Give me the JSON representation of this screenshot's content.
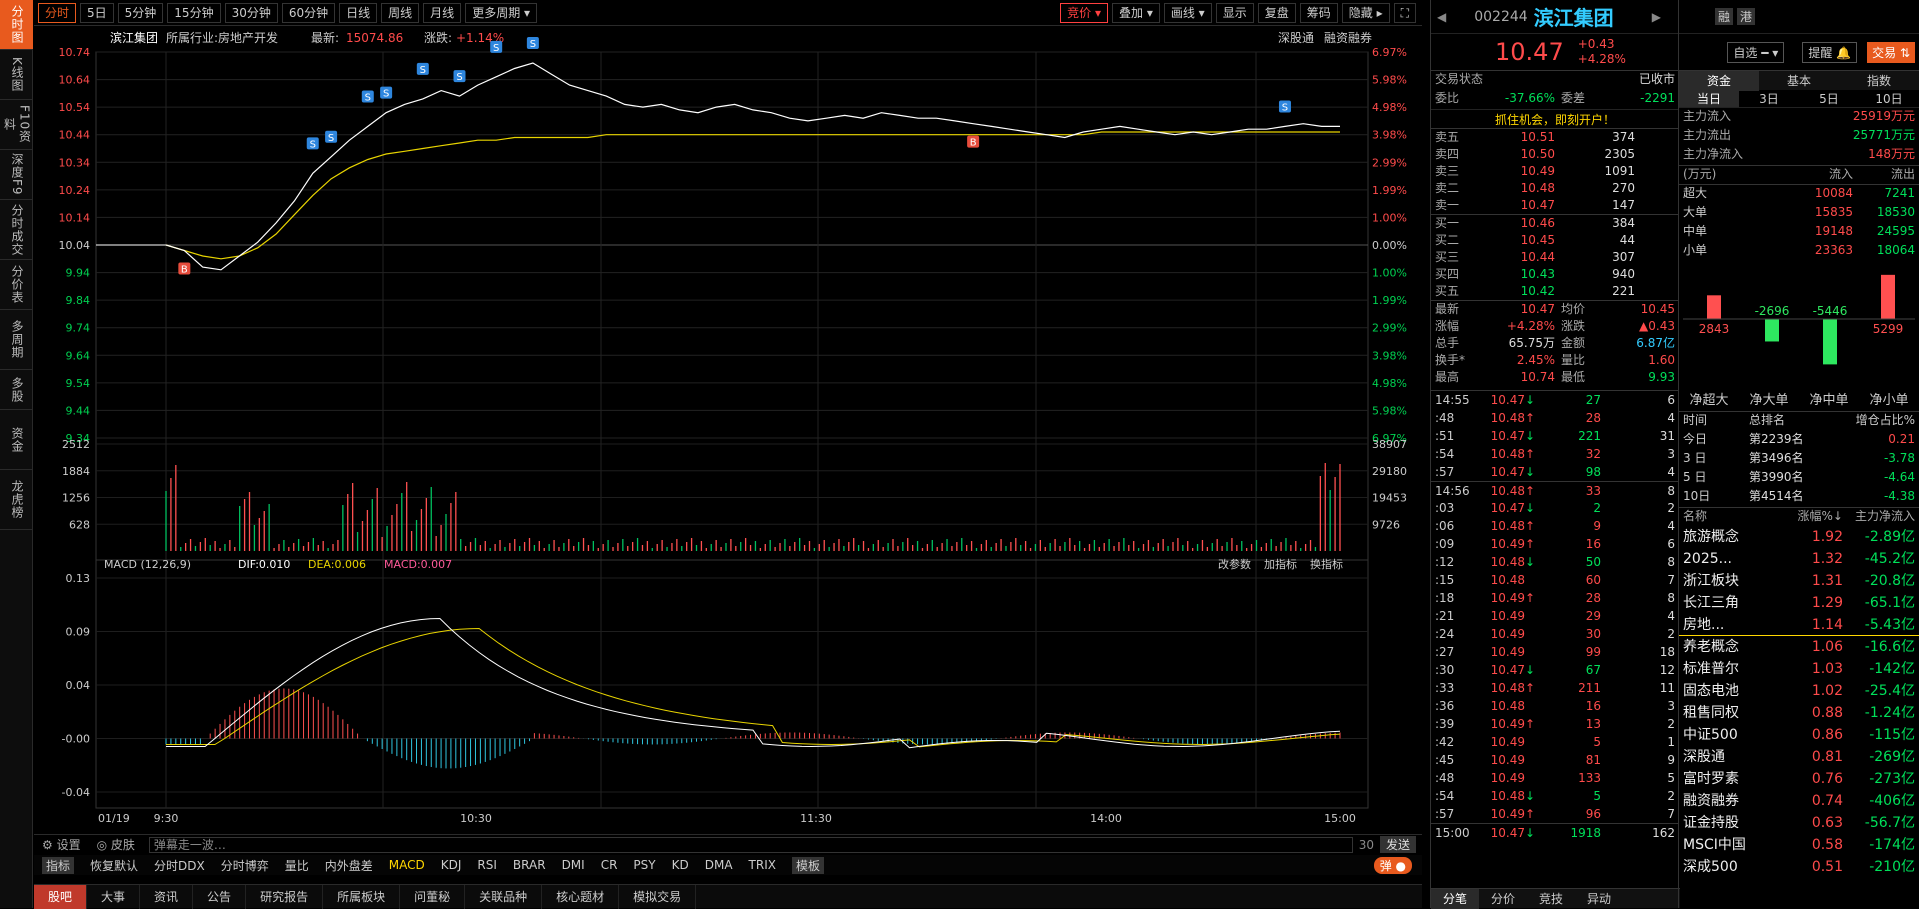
{
  "nav": [
    "分时图",
    "K线图",
    "F10资料",
    "深度F9",
    "分时成交",
    "分价表",
    "多周期",
    "多股",
    "资金",
    "龙虎榜"
  ],
  "topbar": {
    "periods": [
      "分时",
      "5日",
      "5分钟",
      "15分钟",
      "30分钟",
      "60分钟",
      "日线",
      "周线",
      "月线",
      "更多周期"
    ],
    "right": [
      "竞价",
      "叠加",
      "画线",
      "显示",
      "复盘",
      "筹码",
      "隐藏"
    ]
  },
  "stock": {
    "name": "滨江集团",
    "industry_label": "所属行业:",
    "industry": "房地产开发",
    "latest_label": "最新:",
    "latest": "15074.86",
    "change_label": "涨跌:",
    "change": "+1.14%",
    "tags": [
      "深股通",
      "融资融券"
    ]
  },
  "chart_data": {
    "type": "line",
    "title": "滨江集团 分时",
    "x_ticks": [
      "9:30",
      "10:30",
      "11:30",
      "14:00",
      "15:00"
    ],
    "date": "01/19",
    "price_ticks": [
      "10.74",
      "10.64",
      "10.54",
      "10.44",
      "10.34",
      "10.24",
      "10.14",
      "10.04",
      "9.94",
      "9.84",
      "9.74",
      "9.64",
      "9.54",
      "9.44",
      "9.34"
    ],
    "pct_ticks": [
      "6.97%",
      "5.98%",
      "4.98%",
      "3.98%",
      "2.99%",
      "1.99%",
      "1.00%",
      "0.00%",
      "1.00%",
      "1.99%",
      "2.99%",
      "3.98%",
      "4.98%",
      "5.98%",
      "6.97%"
    ],
    "vol_ticks_left": [
      "2512",
      "1884",
      "1256",
      "628"
    ],
    "vol_ticks_right": [
      "38907",
      "29180",
      "19453",
      "9726"
    ],
    "macd_ticks": [
      "0.13",
      "0.09",
      "0.04",
      "-0.00",
      "-0.04"
    ],
    "macd_label": "MACD (12,26,9)",
    "dif": "DIF:0.010",
    "dea": "DEA:0.006",
    "macd": "MACD:0.007",
    "macd_actions": [
      "改参数",
      "加指标",
      "换指标"
    ],
    "price": [
      10.04,
      10.02,
      9.96,
      9.95,
      10.0,
      10.05,
      10.12,
      10.2,
      10.3,
      10.36,
      10.42,
      10.47,
      10.52,
      10.55,
      10.57,
      10.6,
      10.58,
      10.62,
      10.65,
      10.68,
      10.7,
      10.66,
      10.62,
      10.6,
      10.58,
      10.55,
      10.54,
      10.55,
      10.53,
      10.52,
      10.54,
      10.55,
      10.53,
      10.52,
      10.5,
      10.49,
      10.5,
      10.51,
      10.5,
      10.52,
      10.51,
      10.5,
      10.5,
      10.49,
      10.48,
      10.47,
      10.46,
      10.45,
      10.44,
      10.43,
      10.45,
      10.46,
      10.47,
      10.46,
      10.45,
      10.44,
      10.45,
      10.44,
      10.45,
      10.46,
      10.46,
      10.47,
      10.48,
      10.47,
      10.47
    ],
    "avg": [
      10.04,
      10.02,
      10.0,
      9.99,
      10.0,
      10.03,
      10.08,
      10.15,
      10.22,
      10.28,
      10.32,
      10.35,
      10.37,
      10.38,
      10.39,
      10.4,
      10.41,
      10.42,
      10.42,
      10.43,
      10.43,
      10.43,
      10.43,
      10.43,
      10.44,
      10.44,
      10.44,
      10.44,
      10.44,
      10.44,
      10.44,
      10.44,
      10.44,
      10.44,
      10.44,
      10.44,
      10.44,
      10.44,
      10.44,
      10.44,
      10.44,
      10.44,
      10.44,
      10.44,
      10.44,
      10.44,
      10.44,
      10.44,
      10.44,
      10.44,
      10.44,
      10.45,
      10.45,
      10.45,
      10.45,
      10.45,
      10.45,
      10.45,
      10.45,
      10.45,
      10.45,
      10.45,
      10.45,
      10.45,
      10.45
    ],
    "preclose": 10.04,
    "ymin": 9.34,
    "ymax": 10.74,
    "buy_sell_markers": [
      "B",
      "S",
      "S",
      "S",
      "S",
      "S",
      "S",
      "S",
      "S",
      "B",
      "S"
    ]
  },
  "macd_bar_label": "弹幕走一波…",
  "bottom": {
    "settings": "设置",
    "skin": "皮肤",
    "send": "发送",
    "count": "30"
  },
  "indicators": [
    "指标",
    "恢复默认",
    "分时DDX",
    "分时博弈",
    "量比",
    "内外盘差",
    "MACD",
    "KDJ",
    "RSI",
    "BRAR",
    "DMI",
    "CR",
    "PSY",
    "KD",
    "DMA",
    "TRIX",
    "模板"
  ],
  "btabs": [
    "股吧",
    "大事",
    "资讯",
    "公告",
    "研究报告",
    "所属板块",
    "问董秘",
    "关联品种",
    "核心题材",
    "模拟交易"
  ],
  "quote": {
    "code": "002244",
    "name": "滨江集团",
    "price": "10.47",
    "chg": "+0.43",
    "pct": "+4.28%",
    "tags": [
      "融",
      "港"
    ],
    "actions": [
      "自选",
      "提醒",
      "交易"
    ],
    "status_label": "交易状态",
    "status": "已收市",
    "wb_label": "委比",
    "wb": "-37.66%",
    "wc_label": "委差",
    "wc": "-2291",
    "promo": "抓住机会，即刻开户！",
    "asks": [
      [
        "卖五",
        "10.51",
        "374"
      ],
      [
        "卖四",
        "10.50",
        "2305"
      ],
      [
        "卖三",
        "10.49",
        "1091"
      ],
      [
        "卖二",
        "10.48",
        "270"
      ],
      [
        "卖一",
        "10.47",
        "147"
      ]
    ],
    "bids": [
      [
        "买一",
        "10.46",
        "384"
      ],
      [
        "买二",
        "10.45",
        "44"
      ],
      [
        "买三",
        "10.44",
        "307"
      ],
      [
        "买四",
        "10.43",
        "940"
      ],
      [
        "买五",
        "10.42",
        "221"
      ]
    ],
    "stats": [
      [
        "最新",
        "10.47",
        "均价",
        "10.45"
      ],
      [
        "涨幅",
        "+4.28%",
        "涨跌",
        "▲0.43"
      ],
      [
        "总手",
        "65.75万",
        "金额",
        "6.87亿"
      ],
      [
        "换手*",
        "2.45%",
        "量比",
        "1.60"
      ],
      [
        "最高",
        "10.74",
        "最低",
        "9.93"
      ]
    ]
  },
  "ticks": [
    [
      "14:55",
      "10.47",
      "↓",
      "27",
      "6"
    ],
    [
      ":48",
      "10.48",
      "↑",
      "28",
      "4"
    ],
    [
      ":51",
      "10.47",
      "↓",
      "221",
      "31"
    ],
    [
      ":54",
      "10.48",
      "↑",
      "32",
      "3"
    ],
    [
      ":57",
      "10.47",
      "↓",
      "98",
      "4"
    ],
    [
      "14:56",
      "10.48",
      "↑",
      "33",
      "8"
    ],
    [
      ":03",
      "10.47",
      "↓",
      "2",
      "2"
    ],
    [
      ":06",
      "10.48",
      "↑",
      "9",
      "4"
    ],
    [
      ":09",
      "10.49",
      "↑",
      "16",
      "6"
    ],
    [
      ":12",
      "10.48",
      "↓",
      "50",
      "8"
    ],
    [
      ":15",
      "10.48",
      "",
      "60",
      "7"
    ],
    [
      ":18",
      "10.49",
      "↑",
      "28",
      "8"
    ],
    [
      ":21",
      "10.49",
      "",
      "29",
      "4"
    ],
    [
      ":24",
      "10.49",
      "",
      "30",
      "2"
    ],
    [
      ":27",
      "10.49",
      "",
      "99",
      "18"
    ],
    [
      ":30",
      "10.47",
      "↓",
      "67",
      "12"
    ],
    [
      ":33",
      "10.48",
      "↑",
      "211",
      "11"
    ],
    [
      ":36",
      "10.48",
      "",
      "16",
      "3"
    ],
    [
      ":39",
      "10.49",
      "↑",
      "13",
      "2"
    ],
    [
      ":42",
      "10.49",
      "",
      "5",
      "1"
    ],
    [
      ":45",
      "10.49",
      "",
      "81",
      "9"
    ],
    [
      ":48",
      "10.49",
      "",
      "133",
      "5"
    ],
    [
      ":54",
      "10.48",
      "↓",
      "5",
      "2"
    ],
    [
      ":57",
      "10.49",
      "↑",
      "96",
      "7"
    ],
    [
      "15:00",
      "10.47",
      "↓",
      "1918",
      "162"
    ]
  ],
  "tick_tabs": [
    "分笔",
    "分价",
    "竞技",
    "异动"
  ],
  "fund": {
    "tabs": [
      "资金",
      "基本",
      "指数"
    ],
    "sub": [
      "当日",
      "3日",
      "5日",
      "10日"
    ],
    "flow": [
      [
        "主力流入",
        "25919万元"
      ],
      [
        "主力流出",
        "25771万元"
      ],
      [
        "主力净流入",
        "148万元"
      ]
    ],
    "unit": "(万元)",
    "in_label": "流入",
    "out_label": "流出",
    "sizes": [
      [
        "超大",
        "10084",
        "7241"
      ],
      [
        "大单",
        "15835",
        "18530"
      ],
      [
        "中单",
        "19148",
        "24595"
      ],
      [
        "小单",
        "23363",
        "18064"
      ]
    ],
    "net_values": [
      "2843",
      "-2696",
      "-5446",
      "5299"
    ],
    "net_labels": [
      "净超大",
      "净大单",
      "净中单",
      "净小单"
    ],
    "rank_head": [
      "时间",
      "总排名",
      "增仓占比%"
    ],
    "rank": [
      [
        "今日",
        "第2239名",
        "0.21"
      ],
      [
        "3 日",
        "第3496名",
        "-3.78"
      ],
      [
        "5 日",
        "第3990名",
        "-4.64"
      ],
      [
        "10日",
        "第4514名",
        "-4.38"
      ]
    ],
    "sector_head": [
      "名称",
      "涨幅%↓",
      "主力净流入"
    ],
    "sectors": [
      [
        "旅游概念",
        "1.92",
        "-2.89亿"
      ],
      [
        "2025...",
        "1.32",
        "-45.2亿"
      ],
      [
        "浙江板块",
        "1.31",
        "-20.8亿"
      ],
      [
        "长江三角",
        "1.29",
        "-65.1亿"
      ],
      [
        "房地...",
        "1.14",
        "-5.43亿"
      ],
      [
        "养老概念",
        "1.06",
        "-16.6亿"
      ],
      [
        "标准普尔",
        "1.03",
        "-142亿"
      ],
      [
        "固态电池",
        "1.02",
        "-25.4亿"
      ],
      [
        "租售同权",
        "0.88",
        "-1.24亿"
      ],
      [
        "中证500",
        "0.86",
        "-115亿"
      ],
      [
        "深股通",
        "0.81",
        "-269亿"
      ],
      [
        "富时罗素",
        "0.76",
        "-273亿"
      ],
      [
        "融资融券",
        "0.74",
        "-406亿"
      ],
      [
        "证金持股",
        "0.63",
        "-56.7亿"
      ],
      [
        "MSCI中国",
        "0.58",
        "-174亿"
      ],
      [
        "深成500",
        "0.51",
        "-210亿"
      ]
    ]
  }
}
